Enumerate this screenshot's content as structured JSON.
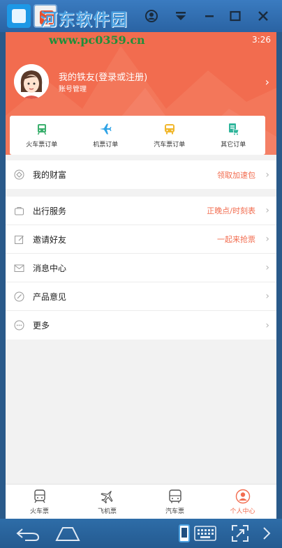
{
  "watermark": {
    "text": "河东软件园",
    "url": "www.pc0359.cn"
  },
  "window": {
    "controls": [
      "account-icon",
      "dropdown-icon",
      "minimize-icon",
      "maximize-icon",
      "close-icon"
    ]
  },
  "status": {
    "time": "3:26"
  },
  "profile": {
    "name": "我的铁友(登录或注册)",
    "sub": "账号管理"
  },
  "orders": [
    {
      "label": "火车票订单",
      "icon": "train-icon",
      "color": "#3cb06e"
    },
    {
      "label": "机票订单",
      "icon": "plane-icon",
      "color": "#2ea3e6"
    },
    {
      "label": "汽车票订单",
      "icon": "bus-icon",
      "color": "#f1b72c"
    },
    {
      "label": "其它订单",
      "icon": "cart-icon",
      "color": "#2fb59b"
    }
  ],
  "menu1": [
    {
      "label": "我的财富",
      "right": "领取加速包"
    }
  ],
  "menu2": [
    {
      "label": "出行服务",
      "right": "正晚点/时刻表"
    },
    {
      "label": "邀请好友",
      "right": "一起来抢票"
    },
    {
      "label": "消息中心",
      "right": ""
    },
    {
      "label": "产品意见",
      "right": ""
    },
    {
      "label": "更多",
      "right": ""
    }
  ],
  "tabs": [
    {
      "label": "火车票",
      "active": false
    },
    {
      "label": "飞机票",
      "active": false
    },
    {
      "label": "汽车票",
      "active": false
    },
    {
      "label": "个人中心",
      "active": true
    }
  ],
  "colors": {
    "accent": "#f26c4f",
    "bg": "#f2f2f2"
  }
}
